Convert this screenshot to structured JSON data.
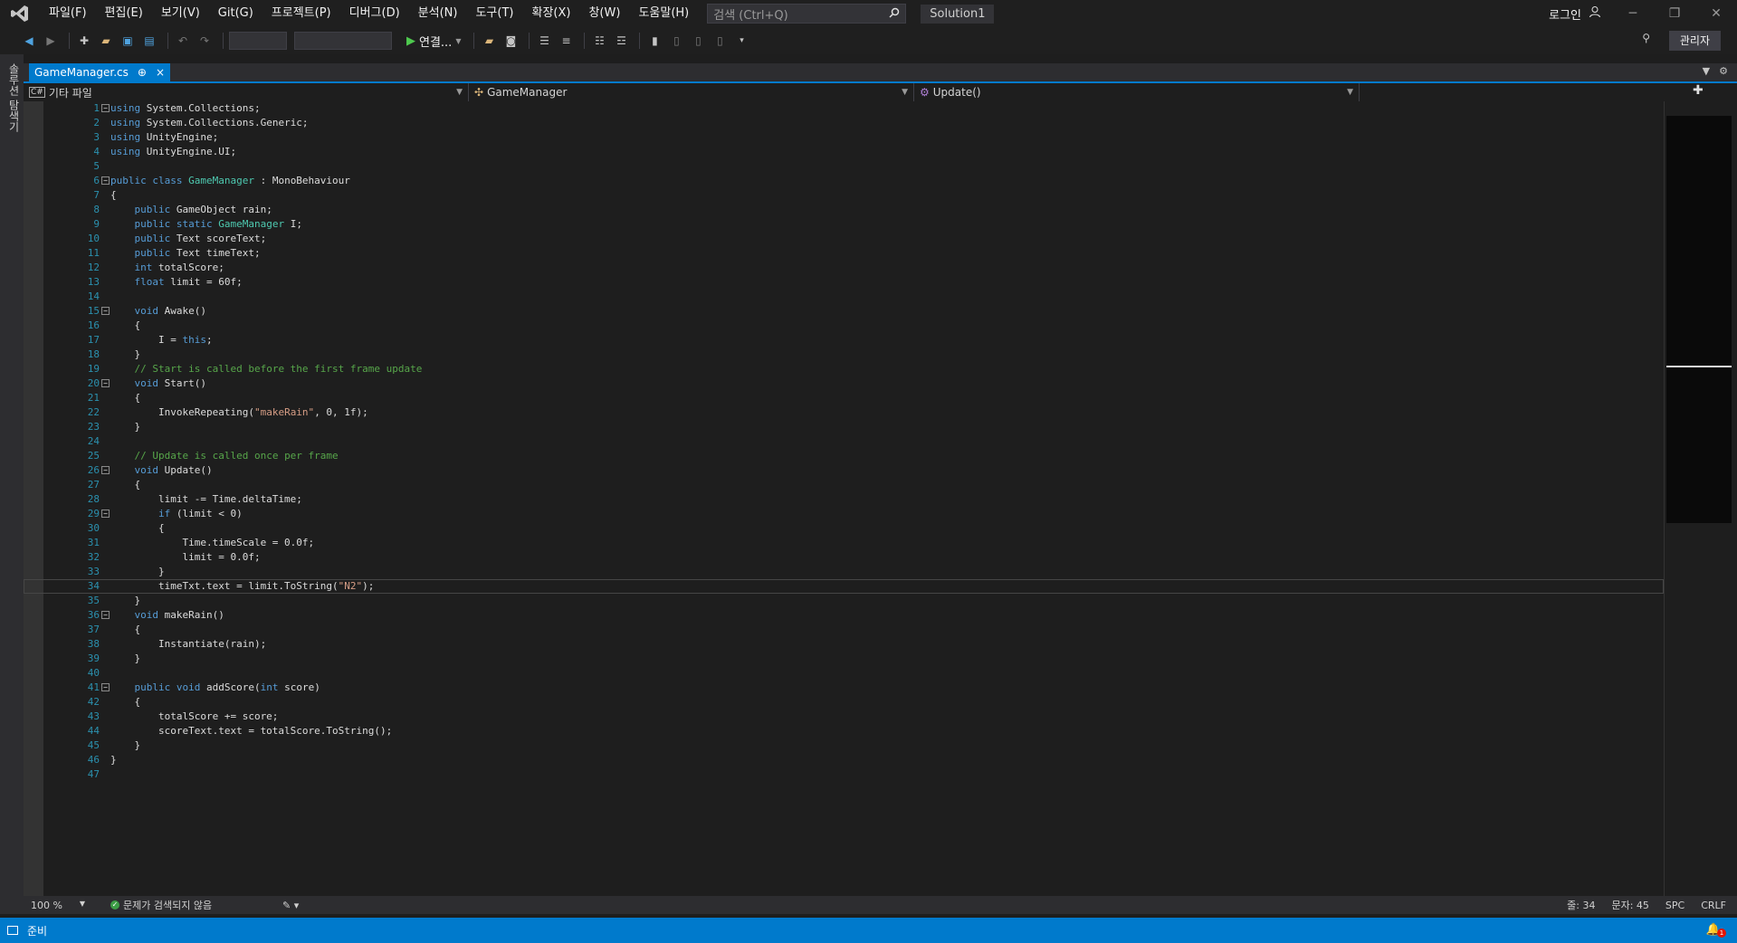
{
  "menu": {
    "items": [
      "파일(F)",
      "편집(E)",
      "보기(V)",
      "Git(G)",
      "프로젝트(P)",
      "디버그(D)",
      "분석(N)",
      "도구(T)",
      "확장(X)",
      "창(W)",
      "도움말(H)"
    ],
    "search_placeholder": "검색 (Ctrl+Q)",
    "solution_name": "Solution1",
    "login_label": "로그인"
  },
  "toolbar": {
    "run_label": "연결...",
    "admin_label": "관리자"
  },
  "side_rail": {
    "label": "솔루션 탐색기"
  },
  "tab": {
    "title": "GameManager.cs",
    "pin_symbol": "⊕",
    "close_symbol": "×"
  },
  "nav": {
    "project": "기타 파일",
    "class": "GameManager",
    "member": "Update()"
  },
  "editor": {
    "current_line": 34,
    "lines": [
      {
        "n": 1,
        "fold": "−",
        "t": [
          [
            "kw",
            "using"
          ],
          [
            "plain",
            " System.Collections;"
          ]
        ]
      },
      {
        "n": 2,
        "fold": "",
        "t": [
          [
            "kw",
            "using"
          ],
          [
            "plain",
            " System.Collections.Generic;"
          ]
        ]
      },
      {
        "n": 3,
        "fold": "",
        "t": [
          [
            "kw",
            "using"
          ],
          [
            "plain",
            " UnityEngine;"
          ]
        ]
      },
      {
        "n": 4,
        "fold": "",
        "t": [
          [
            "kw",
            "using"
          ],
          [
            "plain",
            " UnityEngine.UI;"
          ]
        ]
      },
      {
        "n": 5,
        "fold": "",
        "t": []
      },
      {
        "n": 6,
        "fold": "−",
        "t": [
          [
            "kw",
            "public class "
          ],
          [
            "type",
            "GameManager"
          ],
          [
            "plain",
            " : MonoBehaviour"
          ]
        ]
      },
      {
        "n": 7,
        "fold": "",
        "t": [
          [
            "plain",
            "{"
          ]
        ]
      },
      {
        "n": 8,
        "fold": "",
        "t": [
          [
            "plain",
            "    "
          ],
          [
            "kw",
            "public"
          ],
          [
            "plain",
            " GameObject rain;"
          ]
        ]
      },
      {
        "n": 9,
        "fold": "",
        "t": [
          [
            "plain",
            "    "
          ],
          [
            "kw",
            "public static "
          ],
          [
            "type",
            "GameManager"
          ],
          [
            "plain",
            " I;"
          ]
        ]
      },
      {
        "n": 10,
        "fold": "",
        "t": [
          [
            "plain",
            "    "
          ],
          [
            "kw",
            "public"
          ],
          [
            "plain",
            " Text scoreText;"
          ]
        ]
      },
      {
        "n": 11,
        "fold": "",
        "t": [
          [
            "plain",
            "    "
          ],
          [
            "kw",
            "public"
          ],
          [
            "plain",
            " Text timeText;"
          ]
        ]
      },
      {
        "n": 12,
        "fold": "",
        "t": [
          [
            "plain",
            "    "
          ],
          [
            "kw",
            "int"
          ],
          [
            "plain",
            " totalScore;"
          ]
        ]
      },
      {
        "n": 13,
        "fold": "",
        "t": [
          [
            "plain",
            "    "
          ],
          [
            "kw",
            "float"
          ],
          [
            "plain",
            " limit = 60f;"
          ]
        ]
      },
      {
        "n": 14,
        "fold": "",
        "t": []
      },
      {
        "n": 15,
        "fold": "−",
        "t": [
          [
            "plain",
            "    "
          ],
          [
            "kw",
            "void"
          ],
          [
            "plain",
            " Awake()"
          ]
        ]
      },
      {
        "n": 16,
        "fold": "",
        "t": [
          [
            "plain",
            "    {"
          ]
        ]
      },
      {
        "n": 17,
        "fold": "",
        "t": [
          [
            "plain",
            "        I = "
          ],
          [
            "kw",
            "this"
          ],
          [
            "plain",
            ";"
          ]
        ]
      },
      {
        "n": 18,
        "fold": "",
        "t": [
          [
            "plain",
            "    }"
          ]
        ]
      },
      {
        "n": 19,
        "fold": "",
        "t": [
          [
            "plain",
            "    "
          ],
          [
            "com",
            "// Start is called before the first frame update"
          ]
        ]
      },
      {
        "n": 20,
        "fold": "−",
        "t": [
          [
            "plain",
            "    "
          ],
          [
            "kw",
            "void"
          ],
          [
            "plain",
            " Start()"
          ]
        ]
      },
      {
        "n": 21,
        "fold": "",
        "t": [
          [
            "plain",
            "    {"
          ]
        ]
      },
      {
        "n": 22,
        "fold": "",
        "t": [
          [
            "plain",
            "        InvokeRepeating("
          ],
          [
            "str",
            "\"makeRain\""
          ],
          [
            "plain",
            ", 0, 1f);"
          ]
        ]
      },
      {
        "n": 23,
        "fold": "",
        "t": [
          [
            "plain",
            "    }"
          ]
        ]
      },
      {
        "n": 24,
        "fold": "",
        "t": []
      },
      {
        "n": 25,
        "fold": "",
        "t": [
          [
            "plain",
            "    "
          ],
          [
            "com",
            "// Update is called once per frame"
          ]
        ]
      },
      {
        "n": 26,
        "fold": "−",
        "t": [
          [
            "plain",
            "    "
          ],
          [
            "kw",
            "void"
          ],
          [
            "plain",
            " Update()"
          ]
        ]
      },
      {
        "n": 27,
        "fold": "",
        "t": [
          [
            "plain",
            "    {"
          ]
        ]
      },
      {
        "n": 28,
        "fold": "",
        "t": [
          [
            "plain",
            "        limit -= Time.deltaTime;"
          ]
        ]
      },
      {
        "n": 29,
        "fold": "−",
        "t": [
          [
            "plain",
            "        "
          ],
          [
            "kw",
            "if"
          ],
          [
            "plain",
            " (limit < 0)"
          ]
        ]
      },
      {
        "n": 30,
        "fold": "",
        "t": [
          [
            "plain",
            "        {"
          ]
        ]
      },
      {
        "n": 31,
        "fold": "",
        "t": [
          [
            "plain",
            "            Time.timeScale = 0.0f;"
          ]
        ]
      },
      {
        "n": 32,
        "fold": "",
        "t": [
          [
            "plain",
            "            limit = 0.0f;"
          ]
        ]
      },
      {
        "n": 33,
        "fold": "",
        "t": [
          [
            "plain",
            "        }"
          ]
        ]
      },
      {
        "n": 34,
        "fold": "",
        "t": [
          [
            "plain",
            "        timeTxt.text = limit.ToString("
          ],
          [
            "str",
            "\"N2\""
          ],
          [
            "plain",
            ");"
          ]
        ]
      },
      {
        "n": 35,
        "fold": "",
        "t": [
          [
            "plain",
            "    }"
          ]
        ]
      },
      {
        "n": 36,
        "fold": "−",
        "t": [
          [
            "plain",
            "    "
          ],
          [
            "kw",
            "void"
          ],
          [
            "plain",
            " makeRain()"
          ]
        ]
      },
      {
        "n": 37,
        "fold": "",
        "t": [
          [
            "plain",
            "    {"
          ]
        ]
      },
      {
        "n": 38,
        "fold": "",
        "t": [
          [
            "plain",
            "        Instantiate(rain);"
          ]
        ]
      },
      {
        "n": 39,
        "fold": "",
        "t": [
          [
            "plain",
            "    }"
          ]
        ]
      },
      {
        "n": 40,
        "fold": "",
        "t": []
      },
      {
        "n": 41,
        "fold": "−",
        "t": [
          [
            "plain",
            "    "
          ],
          [
            "kw",
            "public void"
          ],
          [
            "plain",
            " addScore("
          ],
          [
            "kw",
            "int"
          ],
          [
            "plain",
            " score)"
          ]
        ]
      },
      {
        "n": 42,
        "fold": "",
        "t": [
          [
            "plain",
            "    {"
          ]
        ]
      },
      {
        "n": 43,
        "fold": "",
        "t": [
          [
            "plain",
            "        totalScore += score;"
          ]
        ]
      },
      {
        "n": 44,
        "fold": "",
        "t": [
          [
            "plain",
            "        scoreText.text = totalScore.ToString();"
          ]
        ]
      },
      {
        "n": 45,
        "fold": "",
        "t": [
          [
            "plain",
            "    }"
          ]
        ]
      },
      {
        "n": 46,
        "fold": "",
        "t": [
          [
            "plain",
            "}"
          ]
        ]
      },
      {
        "n": 47,
        "fold": "",
        "t": []
      }
    ]
  },
  "editor_status": {
    "zoom": "100 %",
    "issues": "문제가 검색되지 않음",
    "line": "줄: 34",
    "col": "문자: 45",
    "whitespace": "SPC",
    "line_ending": "CRLF"
  },
  "statusbar": {
    "ready": "준비",
    "notifications": "1"
  },
  "colors": {
    "accent": "#007acc",
    "keyword": "#569cd6",
    "type": "#4ec9b0",
    "string": "#d69d85",
    "comment": "#57a64a"
  },
  "icons": [
    "vs-logo-icon",
    "search-icon",
    "user-icon",
    "minimize-icon",
    "restore-icon",
    "close-icon",
    "back-icon",
    "forward-icon",
    "new-project-icon",
    "open-icon",
    "save-icon",
    "save-all-icon",
    "undo-icon",
    "redo-icon",
    "play-icon",
    "bookmark-icon",
    "pin-icon",
    "bell-icon"
  ]
}
